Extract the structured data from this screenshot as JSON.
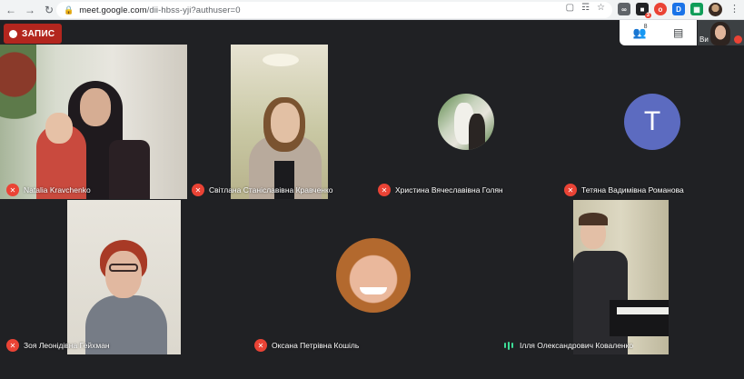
{
  "browser": {
    "url_host": "meet.google.com",
    "url_path": "/dii-hbss-yji?authuser=0",
    "ext_badge": "3"
  },
  "meet": {
    "record_label": "ЗАПИС",
    "people_count": "8",
    "self_label": "Ви",
    "participants": [
      {
        "name": "Natalia Kravchenko",
        "mic": "off"
      },
      {
        "name": "Світлана Станіславівна Кравченко",
        "mic": "off"
      },
      {
        "name": "Христина Вячеславівна Голян",
        "mic": "off"
      },
      {
        "name": "Тетяна Вадимівна Романова",
        "mic": "off",
        "initial": "T"
      },
      {
        "name": "Зоя Леонідівна Гейхман",
        "mic": "off"
      },
      {
        "name": "Оксана Петрівна Кошіль",
        "mic": "off"
      },
      {
        "name": "Ілля Олександрович Коваленко",
        "mic": "on"
      }
    ]
  },
  "colors": {
    "background": "#202124",
    "record": "#b3261e",
    "mic_off": "#ea4335",
    "avatar_t": "#5c6bc0",
    "speaking": "#3ddc97"
  }
}
